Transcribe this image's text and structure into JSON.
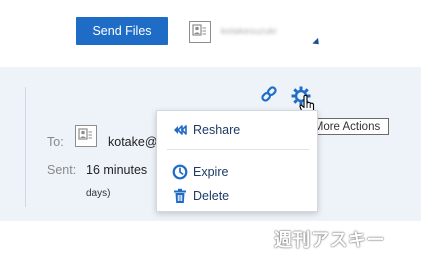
{
  "toolbar": {
    "send_files_label": "Send Files",
    "account_name": "kotakesuzuki"
  },
  "message": {
    "to_label": "To:",
    "to_value": "kotake@",
    "sent_label": "Sent:",
    "sent_value": "16 minutes",
    "days_text": "days)"
  },
  "tooltip": {
    "text": "More Actions"
  },
  "actions_menu": {
    "items": [
      {
        "label": "Reshare",
        "icon": "reshare-icon"
      },
      {
        "label": "Expire",
        "icon": "clock-icon"
      },
      {
        "label": "Delete",
        "icon": "trash-icon"
      }
    ]
  },
  "watermark": {
    "text": "週刊アスキー"
  },
  "colors": {
    "accent": "#1f6cc6",
    "panel_bg": "#eef3fa",
    "menu_text": "#1d3b66"
  }
}
